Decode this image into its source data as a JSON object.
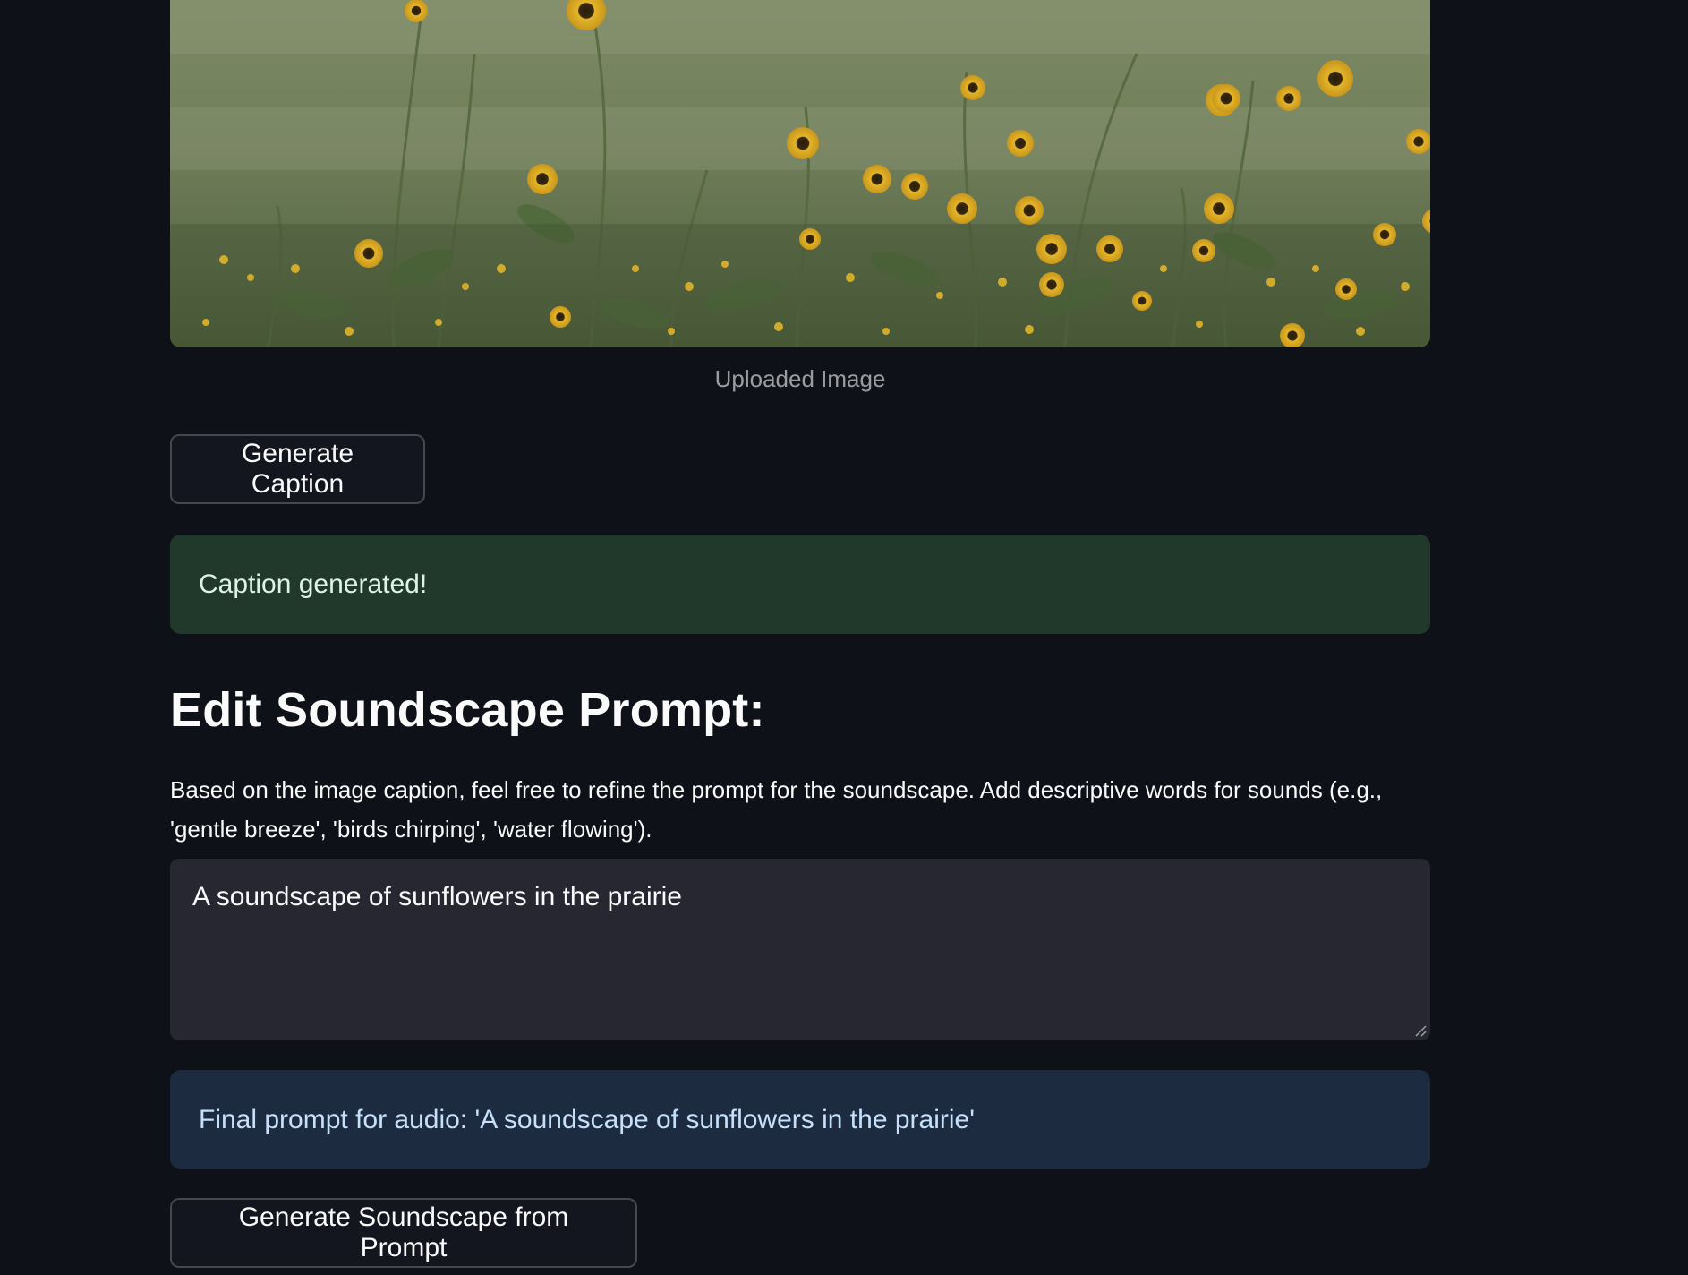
{
  "image": {
    "caption": "Uploaded Image",
    "icon": "sunflower-field-photo"
  },
  "buttons": {
    "generate_caption": "Generate Caption",
    "generate_soundscape": "Generate Soundscape from Prompt"
  },
  "alerts": {
    "success": "Caption generated!",
    "info": "Final prompt for audio: 'A soundscape of sunflowers in the prairie'"
  },
  "prompt_section": {
    "heading": "Edit Soundscape Prompt:",
    "description": "Based on the image caption, feel free to refine the prompt for the soundscape. Add descriptive words for sounds (e.g., 'gentle breeze', 'birds chirping', 'water flowing').",
    "textarea_value": "A soundscape of sunflowers in the prairie"
  },
  "colors": {
    "background": "#0e1117",
    "success_bg": "#21392a",
    "info_bg": "#1c2b40",
    "input_bg": "#262730"
  }
}
